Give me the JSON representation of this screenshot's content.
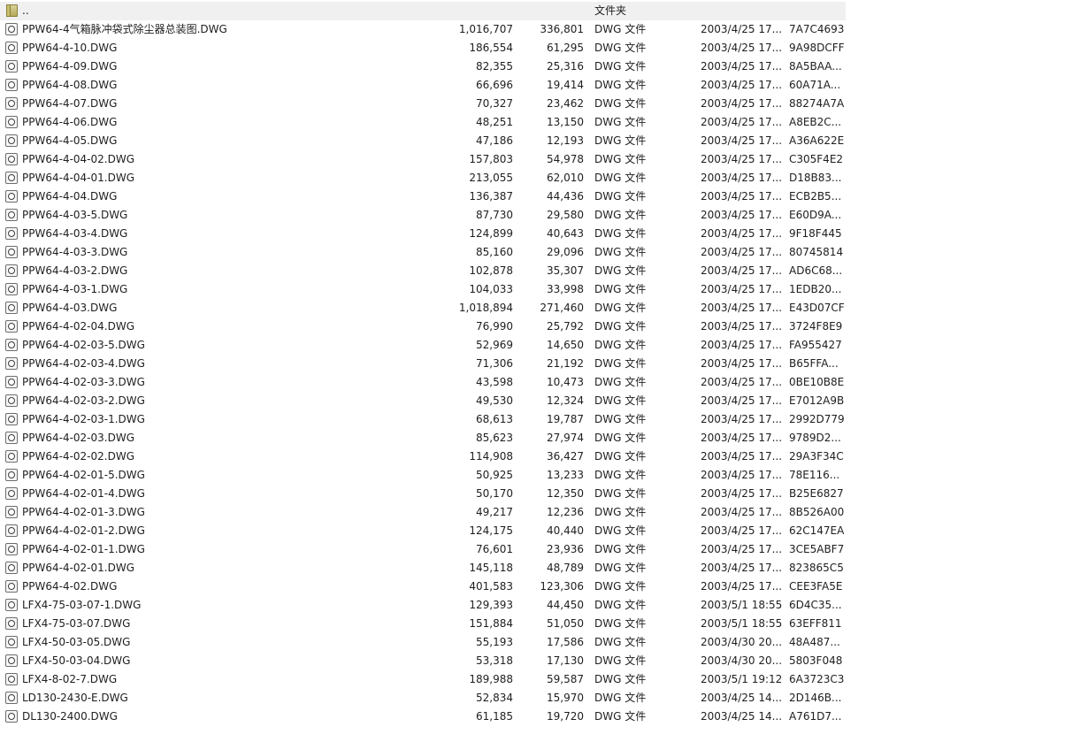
{
  "parent_row": {
    "name": "..",
    "type": "文件夹"
  },
  "files": [
    {
      "name": "PPW64-4气箱脉冲袋式除尘器总装图.DWG",
      "size": "1,016,707",
      "packed": "336,801",
      "type": "DWG 文件",
      "modified": "2003/4/25 17...",
      "crc": "7A7C4693"
    },
    {
      "name": "PPW64-4-10.DWG",
      "size": "186,554",
      "packed": "61,295",
      "type": "DWG 文件",
      "modified": "2003/4/25 17...",
      "crc": "9A98DCFF"
    },
    {
      "name": "PPW64-4-09.DWG",
      "size": "82,355",
      "packed": "25,316",
      "type": "DWG 文件",
      "modified": "2003/4/25 17...",
      "crc": "8A5BAA..."
    },
    {
      "name": "PPW64-4-08.DWG",
      "size": "66,696",
      "packed": "19,414",
      "type": "DWG 文件",
      "modified": "2003/4/25 17...",
      "crc": "60A71A..."
    },
    {
      "name": "PPW64-4-07.DWG",
      "size": "70,327",
      "packed": "23,462",
      "type": "DWG 文件",
      "modified": "2003/4/25 17...",
      "crc": "88274A7A"
    },
    {
      "name": "PPW64-4-06.DWG",
      "size": "48,251",
      "packed": "13,150",
      "type": "DWG 文件",
      "modified": "2003/4/25 17...",
      "crc": "A8EB2C..."
    },
    {
      "name": "PPW64-4-05.DWG",
      "size": "47,186",
      "packed": "12,193",
      "type": "DWG 文件",
      "modified": "2003/4/25 17...",
      "crc": "A36A622E"
    },
    {
      "name": "PPW64-4-04-02.DWG",
      "size": "157,803",
      "packed": "54,978",
      "type": "DWG 文件",
      "modified": "2003/4/25 17...",
      "crc": "C305F4E2"
    },
    {
      "name": "PPW64-4-04-01.DWG",
      "size": "213,055",
      "packed": "62,010",
      "type": "DWG 文件",
      "modified": "2003/4/25 17...",
      "crc": "D18B83..."
    },
    {
      "name": "PPW64-4-04.DWG",
      "size": "136,387",
      "packed": "44,436",
      "type": "DWG 文件",
      "modified": "2003/4/25 17...",
      "crc": "ECB2B5..."
    },
    {
      "name": "PPW64-4-03-5.DWG",
      "size": "87,730",
      "packed": "29,580",
      "type": "DWG 文件",
      "modified": "2003/4/25 17...",
      "crc": "E60D9A..."
    },
    {
      "name": "PPW64-4-03-4.DWG",
      "size": "124,899",
      "packed": "40,643",
      "type": "DWG 文件",
      "modified": "2003/4/25 17...",
      "crc": "9F18F445"
    },
    {
      "name": "PPW64-4-03-3.DWG",
      "size": "85,160",
      "packed": "29,096",
      "type": "DWG 文件",
      "modified": "2003/4/25 17...",
      "crc": "80745814"
    },
    {
      "name": "PPW64-4-03-2.DWG",
      "size": "102,878",
      "packed": "35,307",
      "type": "DWG 文件",
      "modified": "2003/4/25 17...",
      "crc": "AD6C68..."
    },
    {
      "name": "PPW64-4-03-1.DWG",
      "size": "104,033",
      "packed": "33,998",
      "type": "DWG 文件",
      "modified": "2003/4/25 17...",
      "crc": "1EDB20..."
    },
    {
      "name": "PPW64-4-03.DWG",
      "size": "1,018,894",
      "packed": "271,460",
      "type": "DWG 文件",
      "modified": "2003/4/25 17...",
      "crc": "E43D07CF"
    },
    {
      "name": "PPW64-4-02-04.DWG",
      "size": "76,990",
      "packed": "25,792",
      "type": "DWG 文件",
      "modified": "2003/4/25 17...",
      "crc": "3724F8E9"
    },
    {
      "name": "PPW64-4-02-03-5.DWG",
      "size": "52,969",
      "packed": "14,650",
      "type": "DWG 文件",
      "modified": "2003/4/25 17...",
      "crc": "FA955427"
    },
    {
      "name": "PPW64-4-02-03-4.DWG",
      "size": "71,306",
      "packed": "21,192",
      "type": "DWG 文件",
      "modified": "2003/4/25 17...",
      "crc": "B65FFA..."
    },
    {
      "name": "PPW64-4-02-03-3.DWG",
      "size": "43,598",
      "packed": "10,473",
      "type": "DWG 文件",
      "modified": "2003/4/25 17...",
      "crc": "0BE10B8E"
    },
    {
      "name": "PPW64-4-02-03-2.DWG",
      "size": "49,530",
      "packed": "12,324",
      "type": "DWG 文件",
      "modified": "2003/4/25 17...",
      "crc": "E7012A9B"
    },
    {
      "name": "PPW64-4-02-03-1.DWG",
      "size": "68,613",
      "packed": "19,787",
      "type": "DWG 文件",
      "modified": "2003/4/25 17...",
      "crc": "2992D779"
    },
    {
      "name": "PPW64-4-02-03.DWG",
      "size": "85,623",
      "packed": "27,974",
      "type": "DWG 文件",
      "modified": "2003/4/25 17...",
      "crc": "9789D2..."
    },
    {
      "name": "PPW64-4-02-02.DWG",
      "size": "114,908",
      "packed": "36,427",
      "type": "DWG 文件",
      "modified": "2003/4/25 17...",
      "crc": "29A3F34C"
    },
    {
      "name": "PPW64-4-02-01-5.DWG",
      "size": "50,925",
      "packed": "13,233",
      "type": "DWG 文件",
      "modified": "2003/4/25 17...",
      "crc": "78E116..."
    },
    {
      "name": "PPW64-4-02-01-4.DWG",
      "size": "50,170",
      "packed": "12,350",
      "type": "DWG 文件",
      "modified": "2003/4/25 17...",
      "crc": "B25E6827"
    },
    {
      "name": "PPW64-4-02-01-3.DWG",
      "size": "49,217",
      "packed": "12,236",
      "type": "DWG 文件",
      "modified": "2003/4/25 17...",
      "crc": "8B526A00"
    },
    {
      "name": "PPW64-4-02-01-2.DWG",
      "size": "124,175",
      "packed": "40,440",
      "type": "DWG 文件",
      "modified": "2003/4/25 17...",
      "crc": "62C147EA"
    },
    {
      "name": "PPW64-4-02-01-1.DWG",
      "size": "76,601",
      "packed": "23,936",
      "type": "DWG 文件",
      "modified": "2003/4/25 17...",
      "crc": "3CE5ABF7"
    },
    {
      "name": "PPW64-4-02-01.DWG",
      "size": "145,118",
      "packed": "48,789",
      "type": "DWG 文件",
      "modified": "2003/4/25 17...",
      "crc": "823865C5"
    },
    {
      "name": "PPW64-4-02.DWG",
      "size": "401,583",
      "packed": "123,306",
      "type": "DWG 文件",
      "modified": "2003/4/25 17...",
      "crc": "CEE3FA5E"
    },
    {
      "name": "LFX4-75-03-07-1.DWG",
      "size": "129,393",
      "packed": "44,450",
      "type": "DWG 文件",
      "modified": "2003/5/1 18:55",
      "crc": "6D4C35..."
    },
    {
      "name": "LFX4-75-03-07.DWG",
      "size": "151,884",
      "packed": "51,050",
      "type": "DWG 文件",
      "modified": "2003/5/1 18:55",
      "crc": "63EFF811"
    },
    {
      "name": "LFX4-50-03-05.DWG",
      "size": "55,193",
      "packed": "17,586",
      "type": "DWG 文件",
      "modified": "2003/4/30 20...",
      "crc": "48A487..."
    },
    {
      "name": "LFX4-50-03-04.DWG",
      "size": "53,318",
      "packed": "17,130",
      "type": "DWG 文件",
      "modified": "2003/4/30 20...",
      "crc": "5803F048"
    },
    {
      "name": "LFX4-8-02-7.DWG",
      "size": "189,988",
      "packed": "59,587",
      "type": "DWG 文件",
      "modified": "2003/5/1 19:12",
      "crc": "6A3723C3"
    },
    {
      "name": "LD130-2430-E.DWG",
      "size": "52,834",
      "packed": "15,970",
      "type": "DWG 文件",
      "modified": "2003/4/25 14...",
      "crc": "2D146B..."
    },
    {
      "name": "DL130-2400.DWG",
      "size": "61,185",
      "packed": "19,720",
      "type": "DWG 文件",
      "modified": "2003/4/25 14...",
      "crc": "A761D7..."
    }
  ]
}
